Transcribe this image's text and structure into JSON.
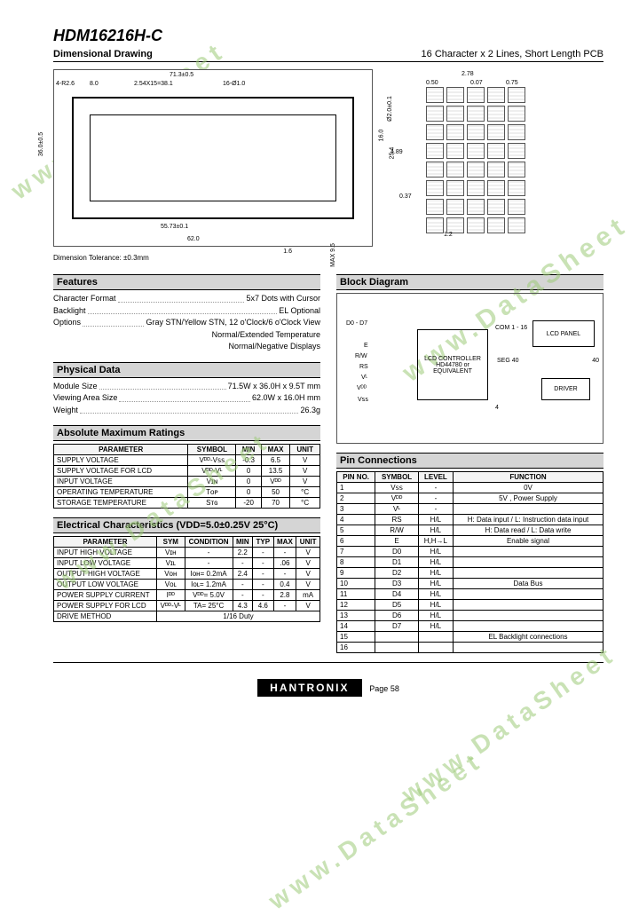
{
  "header": {
    "title": "HDM16216H-C",
    "subtitle": "Dimensional Drawing",
    "spec": "16 Character x 2 Lines, Short Length PCB"
  },
  "dimensions": {
    "w_overall": "71.3±0.5",
    "h_overall": "36.0±0.5",
    "pin_pitch": "2.54X15=38.1",
    "pin_count": "16-Ø1.0",
    "pin_start": "8.0",
    "edge": "4-R2.6",
    "mount_w": "55.73±0.1",
    "va_w": "62.0",
    "va_h": "16.0",
    "side_h": "25.4",
    "hole": "Ø2.0±0.1",
    "thick": "MAX 9.5",
    "lead": "1.6",
    "char_w": "2.78",
    "char_h": "4.89",
    "dot_w": "0.50",
    "dot_gap": "0.07",
    "dot_h": "0.75",
    "row_gap": "0.37",
    "pix": "1.2"
  },
  "tolerance": "Dimension Tolerance: ±0.3mm",
  "features": {
    "heading": "Features",
    "rows": [
      {
        "k": "Character Format",
        "v": "5x7 Dots with Cursor"
      },
      {
        "k": "Backlight",
        "v": "EL Optional"
      },
      {
        "k": "Options",
        "v": "Gray STN/Yellow STN, 12 o'Clock/6 o'Clock View"
      },
      {
        "k": "",
        "v": "Normal/Extended Temperature"
      },
      {
        "k": "",
        "v": "Normal/Negative Displays"
      }
    ]
  },
  "physical": {
    "heading": "Physical Data",
    "rows": [
      {
        "k": "Module Size",
        "v": "71.5W x 36.0H x 9.5T mm"
      },
      {
        "k": "Viewing Area Size",
        "v": "62.0W x 16.0H mm"
      },
      {
        "k": "Weight",
        "v": "26.3g"
      }
    ]
  },
  "block_diagram": {
    "heading": "Block Diagram",
    "signals": [
      "D0 - D7",
      "E",
      "R/W",
      "RS",
      "Vᴸ",
      "Vᴰᴰ",
      "Vꜱꜱ"
    ],
    "controller": "LCD CONTROLLER HD44780 or EQUIVALENT",
    "panel": "LCD PANEL",
    "driver": "DRIVER",
    "com": "COM 1 - 16",
    "seg": "SEG 40",
    "seg2": "40",
    "seg3": "4"
  },
  "abs_max": {
    "heading": "Absolute Maximum Ratings",
    "cols": [
      "PARAMETER",
      "SYMBOL",
      "MIN",
      "MAX",
      "UNIT"
    ],
    "rows": [
      [
        "SUPPLY VOLTAGE",
        "Vᴰᴰ-Vꜱꜱ",
        "-0.3",
        "6.5",
        "V"
      ],
      [
        "SUPPLY VOLTAGE FOR LCD",
        "Vᴰᴰ-Vᴸ",
        "0",
        "13.5",
        "V"
      ],
      [
        "INPUT VOLTAGE",
        "Vɪɴ",
        "0",
        "Vᴰᴰ",
        "V"
      ],
      [
        "OPERATING TEMPERATURE",
        "Tᴏᴘ",
        "0",
        "50",
        "°C"
      ],
      [
        "STORAGE TEMPERATURE",
        "Sᴛɢ",
        "-20",
        "70",
        "°C"
      ]
    ]
  },
  "elec": {
    "heading": "Electrical Characteristics (VDD=5.0±0.25V 25°C)",
    "cols": [
      "PARAMETER",
      "SYM",
      "CONDITION",
      "MIN",
      "TYP",
      "MAX",
      "UNIT"
    ],
    "rows": [
      [
        "INPUT HIGH VOLTAGE",
        "Vɪʜ",
        "-",
        "2.2",
        "-",
        "-",
        "V"
      ],
      [
        "INPUT LOW VOLTAGE",
        "Vɪʟ",
        "-",
        "-",
        "-",
        ".06",
        "V"
      ],
      [
        "OUTPUT HIGH VOLTAGE",
        "Vᴏʜ",
        "Iᴏʜ= 0.2mA",
        "2.4",
        "-",
        "-",
        "V"
      ],
      [
        "OUTPUT LOW VOLTAGE",
        "Vᴏʟ",
        "Iᴏʟ= 1.2mA",
        "-",
        "-",
        "0.4",
        "V"
      ],
      [
        "POWER SUPPLY CURRENT",
        "Iᴰᴰ",
        "Vᴰᴰ= 5.0V",
        "-",
        "-",
        "2.8",
        "mA"
      ],
      [
        "POWER SUPPLY FOR LCD",
        "Vᴰᴰ-Vᴸ",
        "TA= 25°C",
        "4.3",
        "4.6",
        "-",
        "V"
      ],
      [
        "DRIVE METHOD",
        "1/16 Duty",
        "",
        "",
        "",
        "",
        ""
      ]
    ]
  },
  "pins": {
    "heading": "Pin Connections",
    "cols": [
      "PIN NO.",
      "SYMBOL",
      "LEVEL",
      "FUNCTION"
    ],
    "rows": [
      [
        "1",
        "Vꜱꜱ",
        "-",
        "0V"
      ],
      [
        "2",
        "Vᴰᴰ",
        "-",
        "5V , Power Supply"
      ],
      [
        "3",
        "Vᴸ",
        "-",
        ""
      ],
      [
        "4",
        "RS",
        "H/L",
        "H: Data input / L: Instruction data input"
      ],
      [
        "5",
        "R/W",
        "H/L",
        "H: Data read / L: Data write"
      ],
      [
        "6",
        "E",
        "H,H→L",
        "Enable signal"
      ],
      [
        "7",
        "D0",
        "H/L",
        ""
      ],
      [
        "8",
        "D1",
        "H/L",
        ""
      ],
      [
        "9",
        "D2",
        "H/L",
        ""
      ],
      [
        "10",
        "D3",
        "H/L",
        "Data Bus"
      ],
      [
        "11",
        "D4",
        "H/L",
        ""
      ],
      [
        "12",
        "D5",
        "H/L",
        ""
      ],
      [
        "13",
        "D6",
        "H/L",
        ""
      ],
      [
        "14",
        "D7",
        "H/L",
        ""
      ],
      [
        "15",
        "",
        "",
        "EL Backlight connections"
      ],
      [
        "16",
        "",
        "",
        ""
      ]
    ]
  },
  "footer": {
    "brand": "HANTRONIX",
    "page": "Page 58"
  },
  "watermark": "www.DataSheet"
}
